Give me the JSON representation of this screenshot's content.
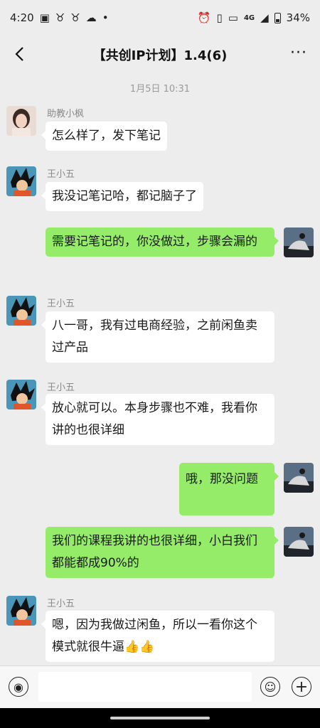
{
  "status": {
    "time": "4:20",
    "net": "4G",
    "battery": "34%"
  },
  "nav": {
    "title": "【共创IP计划】1.4(6)",
    "more": "···"
  },
  "timestamp": "1月5日 10:31",
  "messages": [
    {
      "sender": "助教小枫",
      "text": "怎么样了，发下笔记"
    },
    {
      "sender": "王小五",
      "text": "我没记笔记哈，都记脑子了"
    },
    {
      "sender": "",
      "text": "需要记笔记的，你没做过，步骤会漏的"
    },
    {
      "sender": "王小五",
      "text": "八一哥，我有过电商经验，之前闲鱼卖过产品"
    },
    {
      "sender": "王小五",
      "text": "放心就可以。本身步骤也不难，我看你讲的也很详细"
    },
    {
      "sender": "",
      "text": "哦，那没问题"
    },
    {
      "sender": "",
      "text": "我们的课程我讲的也很详细，小白我们都能都成90%的"
    },
    {
      "sender": "王小五",
      "text": "嗯，因为我做过闲鱼，所以一看你这个模式就很牛逼"
    }
  ],
  "colors": {
    "background": "#ededed",
    "bubble_out": "#95ec69",
    "bubble_in": "#ffffff"
  },
  "icons": [
    "back-icon",
    "more-icon",
    "voice-icon",
    "emoji-icon",
    "plus-icon",
    "thumbs-up-icon"
  ]
}
